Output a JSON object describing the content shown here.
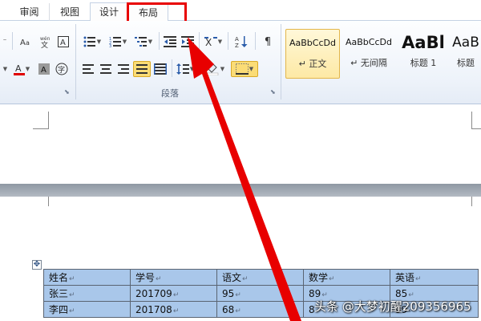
{
  "tabs": [
    {
      "label": "审阅"
    },
    {
      "label": "视图"
    },
    {
      "label": "设计"
    },
    {
      "label": "布局"
    }
  ],
  "paragraph_group": {
    "label": "段落"
  },
  "styles": [
    {
      "preview": "AaBbCcDd",
      "name": "正文"
    },
    {
      "preview": "AaBbCcDd",
      "name": "无间隔"
    },
    {
      "preview": "AaBl",
      "name": "标题 1"
    },
    {
      "preview": "AaB",
      "name": "标题"
    }
  ],
  "table": {
    "rows": [
      [
        "姓名",
        "学号",
        "语文",
        "数学",
        "英语"
      ],
      [
        "张三",
        "201709",
        "95",
        "89",
        "85"
      ],
      [
        "李四",
        "201708",
        "68",
        "8",
        "99"
      ]
    ]
  },
  "colors": {
    "highlight": "#e80000",
    "table_selection": "#a9c7ea"
  },
  "watermark": {
    "text": "头条 @大梦初醒209356965"
  }
}
